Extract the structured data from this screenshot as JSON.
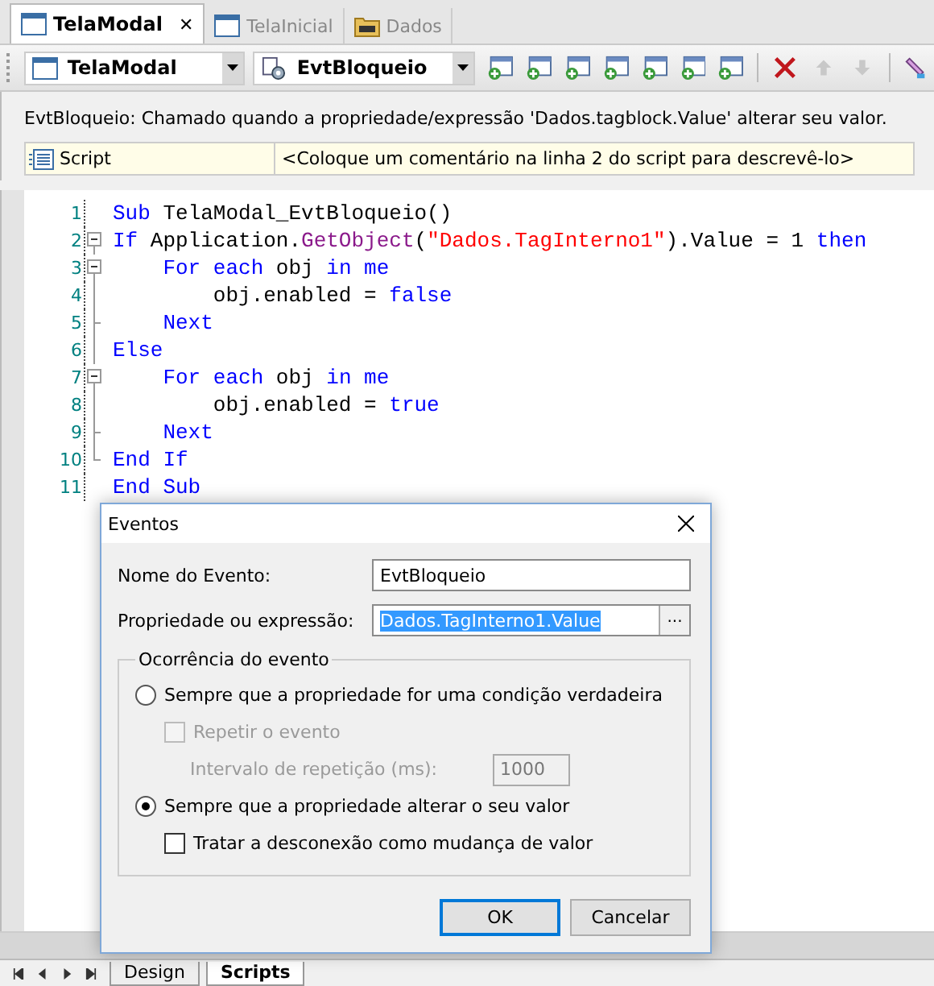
{
  "document_tabs": [
    {
      "label": "TelaModal",
      "selected": true,
      "kind": "screen",
      "close": "✕"
    },
    {
      "label": "TelaInicial",
      "selected": false,
      "kind": "screen"
    },
    {
      "label": "Dados",
      "selected": false,
      "kind": "data"
    }
  ],
  "toolbar": {
    "object_combo": "TelaModal",
    "event_combo": "EvtBloqueio",
    "buttons": [
      {
        "kind": "add",
        "disabled": false
      },
      {
        "kind": "add",
        "disabled": false
      },
      {
        "kind": "add",
        "disabled": false
      },
      {
        "kind": "add",
        "disabled": false
      },
      {
        "kind": "add",
        "disabled": false
      },
      {
        "kind": "add",
        "disabled": false
      },
      {
        "kind": "add",
        "disabled": false
      },
      {
        "kind": "delete",
        "disabled": false
      },
      {
        "kind": "up",
        "disabled": true
      },
      {
        "kind": "down",
        "disabled": true
      },
      {
        "kind": "edit",
        "disabled": false
      }
    ]
  },
  "description": "EvtBloqueio: Chamado quando a propriedade/expressão 'Dados.tagblock.Value' alterar seu valor.",
  "property_row": {
    "name": "Script",
    "value": "<Coloque um comentário na linha 2 do script para descrevê-lo>"
  },
  "code_lines": [
    {
      "number": "1",
      "kind": "plain",
      "tokens": [
        {
          "t": "Sub ",
          "kind": "keyword"
        },
        {
          "t": "TelaModal_EvtBloqueio()",
          "kind": "plain"
        }
      ]
    },
    {
      "number": "2",
      "kind": "fold_start",
      "tokens": [
        {
          "t": "If ",
          "kind": "keyword"
        },
        {
          "t": "Application.",
          "kind": "plain"
        },
        {
          "t": "GetObject",
          "kind": "function"
        },
        {
          "t": "(",
          "kind": "plain"
        },
        {
          "t": "\"Dados.TagInterno1\"",
          "kind": "string"
        },
        {
          "t": ").Value = 1 ",
          "kind": "plain"
        },
        {
          "t": "then",
          "kind": "keyword"
        }
      ]
    },
    {
      "number": "3",
      "kind": "fold_start",
      "tokens": [
        {
          "t": "    For each ",
          "kind": "keyword"
        },
        {
          "t": "obj ",
          "kind": "plain"
        },
        {
          "t": "in me",
          "kind": "keyword"
        }
      ]
    },
    {
      "number": "4",
      "kind": "fold_inner",
      "tokens": [
        {
          "t": "        obj.enabled = ",
          "kind": "plain"
        },
        {
          "t": "false",
          "kind": "keyword"
        }
      ]
    },
    {
      "number": "5",
      "kind": "fold_end",
      "tokens": [
        {
          "t": "    Next",
          "kind": "keyword"
        }
      ]
    },
    {
      "number": "6",
      "kind": "fold_inner",
      "tokens": [
        {
          "t": "Else",
          "kind": "keyword"
        }
      ]
    },
    {
      "number": "7",
      "kind": "fold_start",
      "tokens": [
        {
          "t": "    For each ",
          "kind": "keyword"
        },
        {
          "t": "obj ",
          "kind": "plain"
        },
        {
          "t": "in me",
          "kind": "keyword"
        }
      ]
    },
    {
      "number": "8",
      "kind": "fold_inner",
      "tokens": [
        {
          "t": "        obj.enabled = ",
          "kind": "plain"
        },
        {
          "t": "true",
          "kind": "keyword"
        }
      ]
    },
    {
      "number": "9",
      "kind": "fold_end",
      "tokens": [
        {
          "t": "    Next",
          "kind": "keyword"
        }
      ]
    },
    {
      "number": "10",
      "kind": "fold_last",
      "tokens": [
        {
          "t": "End If",
          "kind": "keyword"
        }
      ]
    },
    {
      "number": "11",
      "kind": "plain",
      "tokens": [
        {
          "t": "End Sub",
          "kind": "keyword"
        }
      ]
    }
  ],
  "bottom_tabs": [
    {
      "label": "Design",
      "selected": false
    },
    {
      "label": "Scripts",
      "selected": true
    }
  ],
  "dialog": {
    "title": "Eventos",
    "name_label": "Nome do Evento:",
    "name_value": "EvtBloqueio",
    "expr_label": "Propriedade ou expressão:",
    "expr_value": "Dados.TagInterno1.Value",
    "browse": "...",
    "group_title": "Ocorrência do evento",
    "options": [
      {
        "kind": "radio",
        "label": "Sempre que a propriedade for uma condição verdadeira",
        "selected": false
      },
      {
        "kind": "checkbox",
        "label": "Repetir o evento",
        "checked": false,
        "disabled": true
      },
      {
        "kind": "interval",
        "label": "Intervalo de repetição (ms):",
        "value": "1000",
        "disabled": true
      },
      {
        "kind": "radio",
        "label": "Sempre que a propriedade alterar o seu valor",
        "selected": true
      },
      {
        "kind": "checkbox",
        "label": "Tratar a desconexão como mudança de valor",
        "checked": false,
        "disabled": false
      }
    ],
    "buttons": [
      "OK",
      "Cancelar"
    ]
  }
}
